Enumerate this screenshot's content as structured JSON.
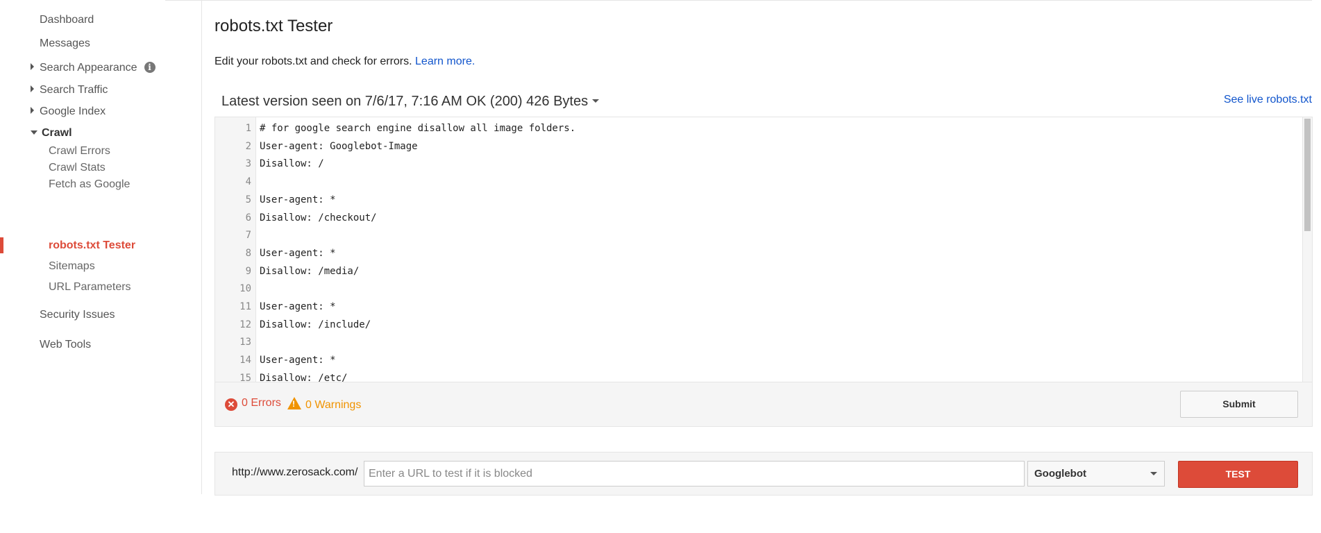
{
  "sidebar": {
    "dashboard": "Dashboard",
    "messages": "Messages",
    "search_appearance": "Search Appearance",
    "info_icon": "i",
    "search_traffic": "Search Traffic",
    "google_index": "Google Index",
    "crawl": "Crawl",
    "crawl_items": [
      "Crawl Errors",
      "Crawl Stats",
      "Fetch as Google",
      "robots.txt Tester",
      "Sitemaps",
      "URL Parameters"
    ],
    "security_issues": "Security Issues",
    "web_tools": "Web Tools"
  },
  "page": {
    "title": "robots.txt Tester",
    "description": "Edit your robots.txt and check for errors.",
    "learn_more": "Learn more.",
    "version_label": "Latest version seen on 7/6/17, 7:16 AM OK (200) 426 Bytes",
    "see_live": "See live robots.txt"
  },
  "editor": {
    "lines": [
      {
        "n": "1",
        "text": "# for google search engine disallow all image folders."
      },
      {
        "n": "2",
        "text": "User-agent: Googlebot-Image"
      },
      {
        "n": "3",
        "text": "Disallow: /"
      },
      {
        "n": "4",
        "text": ""
      },
      {
        "n": "5",
        "text": "User-agent: *"
      },
      {
        "n": "6",
        "text": "Disallow: /checkout/"
      },
      {
        "n": "7",
        "text": ""
      },
      {
        "n": "8",
        "text": "User-agent: *"
      },
      {
        "n": "9",
        "text": "Disallow: /media/"
      },
      {
        "n": "10",
        "text": ""
      },
      {
        "n": "11",
        "text": "User-agent: *"
      },
      {
        "n": "12",
        "text": "Disallow: /include/"
      },
      {
        "n": "13",
        "text": ""
      },
      {
        "n": "14",
        "text": "User-agent: *"
      },
      {
        "n": "15",
        "text": "Disallow: /etc/"
      }
    ]
  },
  "status": {
    "errors": "0 Errors",
    "warnings": "0 Warnings",
    "submit": "Submit"
  },
  "tester": {
    "url_prefix": "http://www.zerosack.com/",
    "placeholder": "Enter a URL to test if it is blocked",
    "agent": "Googlebot",
    "test_button": "TEST"
  },
  "colors": {
    "accent_red": "#dd4b39",
    "link_blue": "#1155cc",
    "warning_orange": "#f09300"
  },
  "icons": [
    "info-icon",
    "triangle-right-icon",
    "triangle-down-icon",
    "dropdown-caret-icon",
    "error-icon",
    "warning-icon"
  ]
}
